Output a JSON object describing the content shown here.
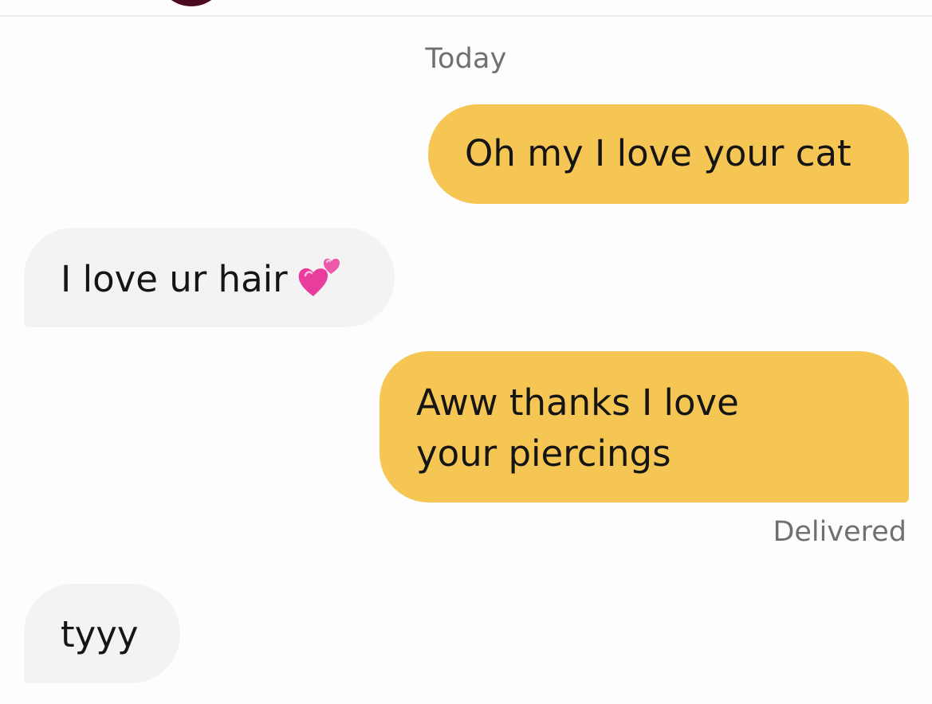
{
  "conversation": {
    "date_label": "Today",
    "messages": [
      {
        "direction": "outgoing",
        "text": "Oh my I love your cat"
      },
      {
        "direction": "incoming",
        "text": "I love ur hair",
        "emoji": "two-hearts-icon"
      },
      {
        "direction": "outgoing",
        "lines": [
          "Aww thanks I love",
          "your piercings"
        ]
      },
      {
        "direction": "incoming",
        "text": "tyyy"
      }
    ],
    "status": "Delivered"
  },
  "colors": {
    "outgoing_bubble": "#f5c653",
    "incoming_bubble": "#f3f3f3",
    "meta_text": "#707070"
  }
}
